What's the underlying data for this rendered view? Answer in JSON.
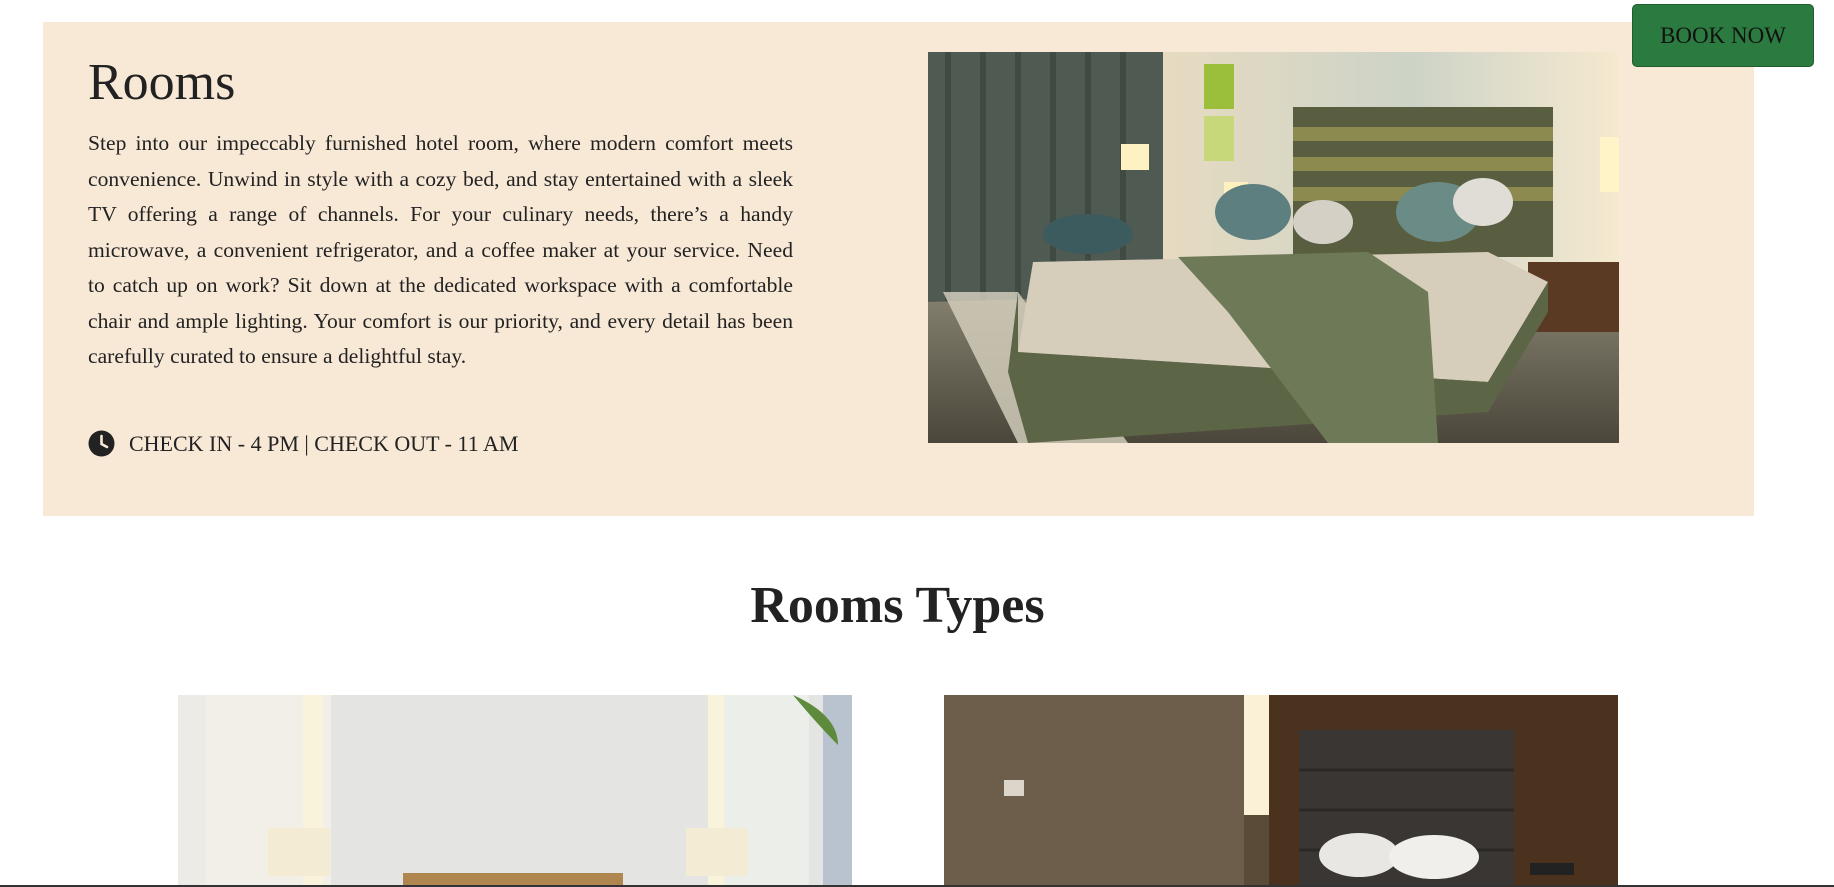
{
  "rooms": {
    "title": "Rooms",
    "description": "Step into our impeccably furnished hotel room, where modern comfort meets convenience. Unwind in style with a cozy bed, and stay entertained with a sleek TV offering a range of channels. For your culinary needs, there’s a handy microwave, a convenient refrigerator, and a coffee maker at your service. Need to catch up on work? Sit down at the dedicated workspace with a comfortable chair and ample lighting. Your comfort is our priority, and every detail has been carefully curated to ensure a delightful stay.",
    "checkin_checkout": "CHECK IN - 4 PM | CHECK OUT - 11 AM",
    "icon": "clock-icon"
  },
  "book_now": {
    "label": "BOOK NOW"
  },
  "room_types": {
    "title": "Rooms Types"
  },
  "colors": {
    "section_bg": "#f8e9d7",
    "book_now_bg": "#2b7a3f",
    "text": "#222222"
  }
}
